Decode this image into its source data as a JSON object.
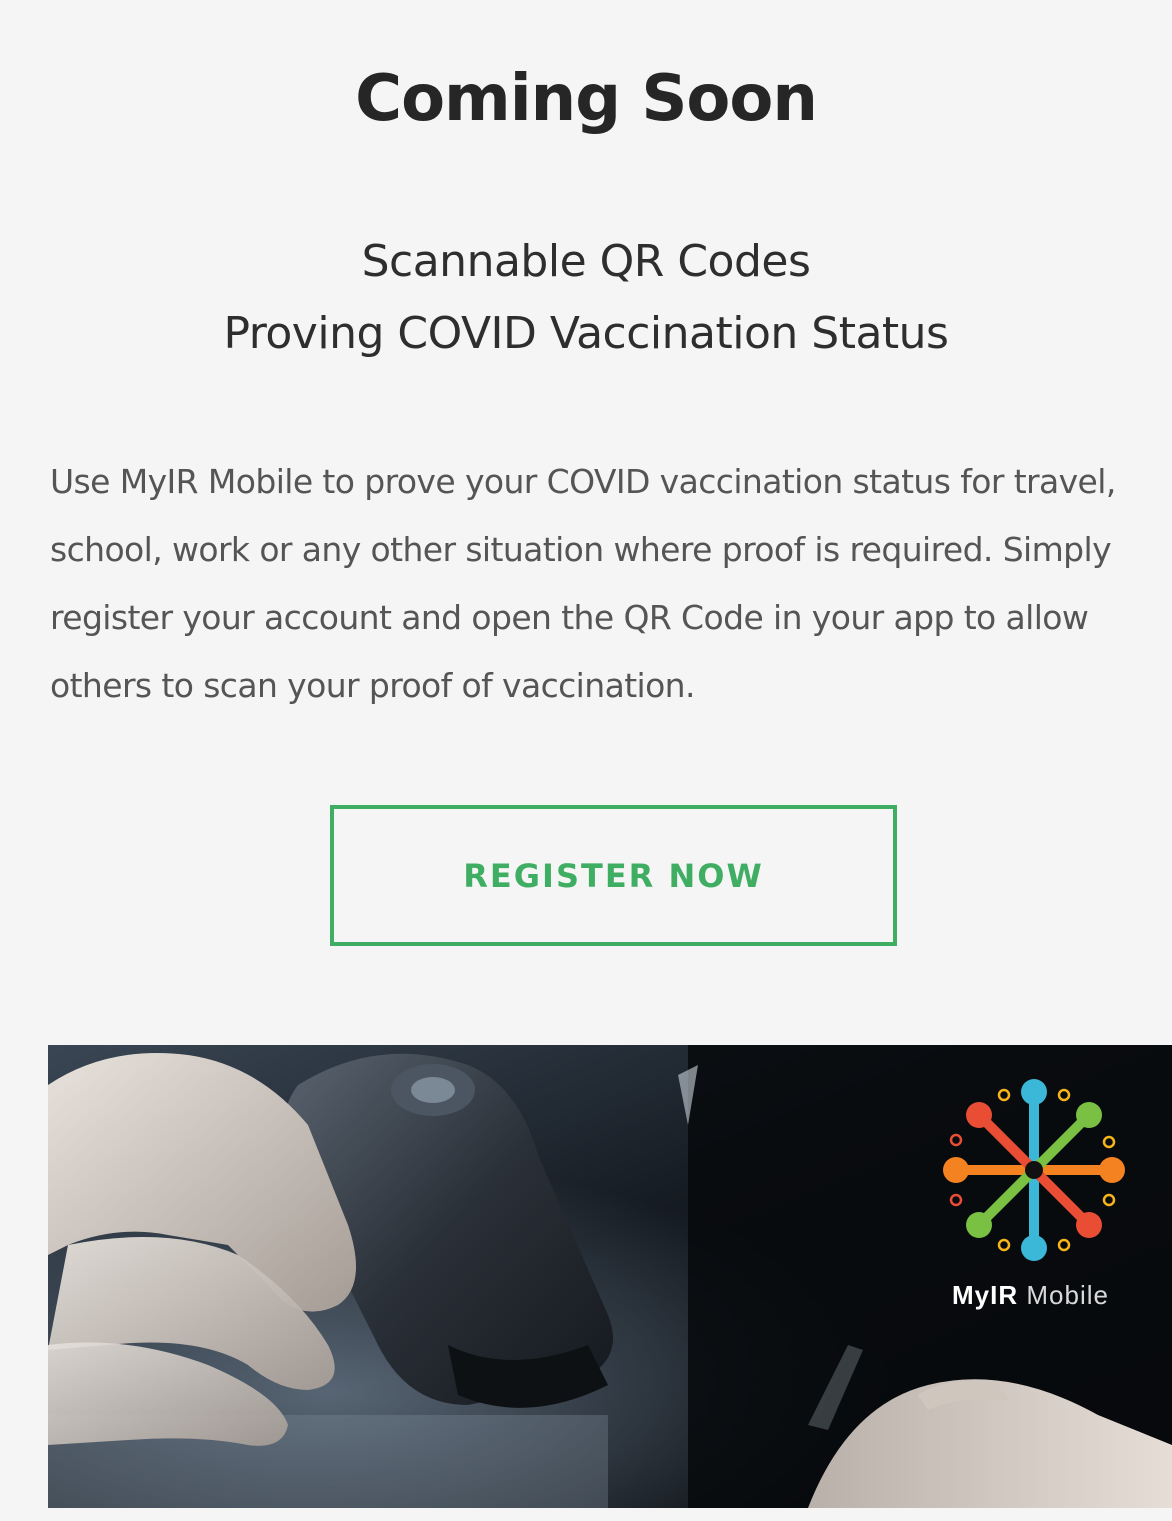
{
  "header": {
    "title": "Coming Soon"
  },
  "subtitle": {
    "line1": "Scannable QR Codes",
    "line2": "Proving COVID Vaccination Status"
  },
  "description": "Use MyIR Mobile to prove your COVID vaccination status for travel, school, work or any other situation where proof is required. Simply register your account and open the QR Code in your app to allow others to scan your proof of vaccination.",
  "cta": {
    "label": "REGISTER NOW",
    "color": "#3fae63"
  },
  "hero": {
    "image_subject": "hand holding barcode scanner",
    "logo": {
      "brand_bold": "MyIR",
      "brand_light": "Mobile",
      "icon": "myir-hub-logo-icon",
      "colors": [
        "#3bb7d8",
        "#7ac143",
        "#f58220",
        "#e94e35",
        "#f7b519"
      ]
    }
  }
}
